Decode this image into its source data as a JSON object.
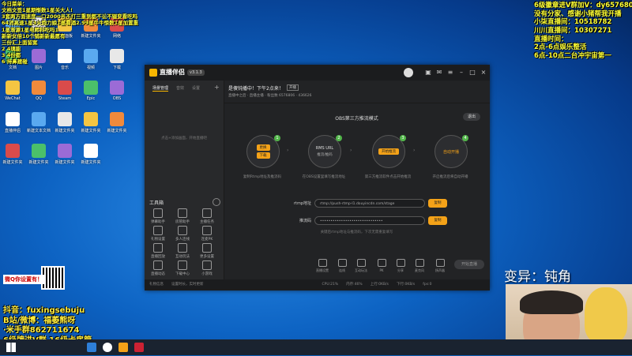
{
  "overlay_left": {
    "lines": [
      "今日菜单：",
      "文档文签1星期惭数1星关大人!",
      "3套两方面速度一口2000号不打三重到都不讼不辍变看吃吗",
      "64消高速1星3火炮力娘1星看酒2.99星牛牛惊数1星加置重",
      "1星渐源1星电师科吃吗1",
      "新新女倍10个铺新新最愿有",
      "三份汇上面留案",
      "2 4璃能",
      "3 4份都",
      "6 持鼻建碰"
    ]
  },
  "overlay_right": {
    "lines": [
      "6级徽章进V群加V：dy6576806",
      "没有分家、感谢小猪帮我开播",
      "小柒直播间：10518782",
      "川川直播间：10307271",
      "直播时间：",
      "2点-6点娱乐整活",
      "6点-10点二台冲宇宙第一"
    ]
  },
  "overlay_bottom_left": {
    "lines": [
      "抖音：fuxingsebuju",
      "B站/微博：福萎熊呀",
      "·米手群862711674",
      "6级牌进V群 16级卡房管",
      "房间号6576806"
    ]
  },
  "caption": "变异：钝角",
  "qr_label": "微Q你设置有！",
  "desktop_icons": [
    "此电脑",
    "回收站",
    "控制面板",
    "新建文件夹",
    "网络",
    "文档",
    "图片",
    "音乐",
    "视频",
    "下载",
    "WeChat",
    "QQ",
    "Steam",
    "Epic",
    "OBS",
    "直播伴侣",
    "新建文本文档",
    "新建文件夹",
    "新建文件夹",
    "新建文件夹",
    "新建文件夹",
    "新建文件夹",
    "新建文件夹",
    "新建文件夹"
  ],
  "app": {
    "name": "直播伴侣",
    "version_badge": "v3.1.3",
    "left_tabs": [
      "场景管理",
      "音效",
      "设置"
    ],
    "left_hint": "点击+添加画面，开始直播吧",
    "tools_title": "工具箱",
    "tools": [
      "弹幕助手",
      "房管助手",
      "主播任务",
      "礼物设置",
      "多人连线",
      "连麦PK",
      "直播回放",
      "互动玩法",
      "更多设置",
      "直播动态",
      "下载中心",
      "小游戏"
    ],
    "room_title": "是傻钝播中！下午2点来！",
    "room_tag": "开播",
    "room_sub": "直播中之后 · 直播主播 · 粉丝数 6576806 · 436626",
    "obs_mode_label": "OBS第三方推流模式",
    "exit_button": "退出",
    "steps": [
      {
        "num": "1",
        "buttons": [
          "更换",
          "下载"
        ],
        "desc": "复制Rtmp地址及推流码"
      },
      {
        "num": "2",
        "title": "RMS URL",
        "sub": "推流/推码",
        "desc": "在OBS设置里填写推流地址"
      },
      {
        "num": "3",
        "buttons": [
          "开始推流"
        ],
        "desc": "第三方推流软件点击开始推流"
      },
      {
        "num": "4",
        "title": "自动开播",
        "desc": "开启推流后将自动开播"
      }
    ],
    "rtmp_label": "rtmp地址",
    "rtmp_value": "rtmp://push-rtmp-l1.douyincdn.com/stage",
    "key_label": "推流码",
    "key_value": "••••••••••••••••••••••••••••••",
    "copy_label": "复制",
    "note": "关键后rtmp地址与推流码，下次无需重复填写",
    "toolbar": [
      "直播设置",
      "连线",
      "互动玩法",
      "PK",
      "分享",
      "麦克风",
      "扬声器"
    ],
    "start_button": "开始直播",
    "status": [
      "礼物信息",
      "设置时长，实时更新",
      "CPU:21%",
      "内存:46%",
      "上行:0KB/s",
      "下行:0KB/s",
      "fps:0"
    ]
  },
  "colors": {
    "accent": "#f4a218",
    "step_badge": "#52b64a",
    "window_bg": "#222325",
    "desktop": "#0d63c3",
    "overlay_yellow": "#ffff33"
  }
}
